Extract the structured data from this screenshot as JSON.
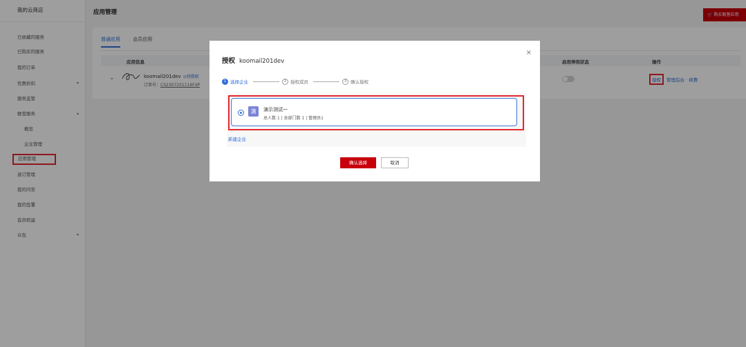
{
  "sidebar": {
    "title": "我的云商店",
    "items": [
      {
        "label": "已收藏的服务",
        "name": "sidebar-item-favorites"
      },
      {
        "label": "已购买的服务",
        "name": "sidebar-item-purchased"
      },
      {
        "label": "我的订单",
        "name": "sidebar-item-orders"
      },
      {
        "label": "优惠折扣",
        "name": "sidebar-item-discounts"
      },
      {
        "label": "服务监管",
        "name": "sidebar-item-service-supervision"
      },
      {
        "label": "联营服务",
        "name": "sidebar-item-joint-services"
      },
      {
        "label": "概览",
        "name": "sidebar-item-overview"
      },
      {
        "label": "企业管理",
        "name": "sidebar-item-enterprise-mgmt"
      },
      {
        "label": "应用管理",
        "name": "sidebar-item-app-mgmt"
      },
      {
        "label": "退订管理",
        "name": "sidebar-item-unsubscribe-mgmt"
      },
      {
        "label": "我的问答",
        "name": "sidebar-item-my-qa"
      },
      {
        "label": "我的签署",
        "name": "sidebar-item-my-signatures"
      },
      {
        "label": "会员权益",
        "name": "sidebar-item-member-benefits"
      },
      {
        "label": "众包",
        "name": "sidebar-item-crowdsourcing"
      }
    ]
  },
  "header": {
    "title": "应用管理",
    "buy_button": "购买联营应用"
  },
  "tabs": [
    {
      "label": "普通应用",
      "active": true
    },
    {
      "label": "会员应用",
      "active": false
    }
  ],
  "table": {
    "columns": {
      "app_info": "应用信息",
      "status": "启用停用状态",
      "actions": "操作"
    },
    "row": {
      "app_name": "koomail201dev",
      "badge": "待授权",
      "order_label": "订单号：",
      "order_no": "CS2307251116F4P",
      "action_auth": "授权",
      "action_manage": "管理后台 · 续费"
    }
  },
  "modal": {
    "title": "授权",
    "subtitle": "koomail201dev",
    "close": "×",
    "steps": [
      {
        "num": "1",
        "label": "选择企业",
        "active": true
      },
      {
        "num": "2",
        "label": "授权成员",
        "active": false
      },
      {
        "num": "3",
        "label": "确认授权",
        "active": false
      }
    ],
    "enterprise": {
      "avatar": "演",
      "name": "演示测试一",
      "stats": "总人数 1 | 总部门数 1 | 管理员1"
    },
    "new_enterprise": "新建企业",
    "confirm": "确认选择",
    "cancel": "取消"
  }
}
